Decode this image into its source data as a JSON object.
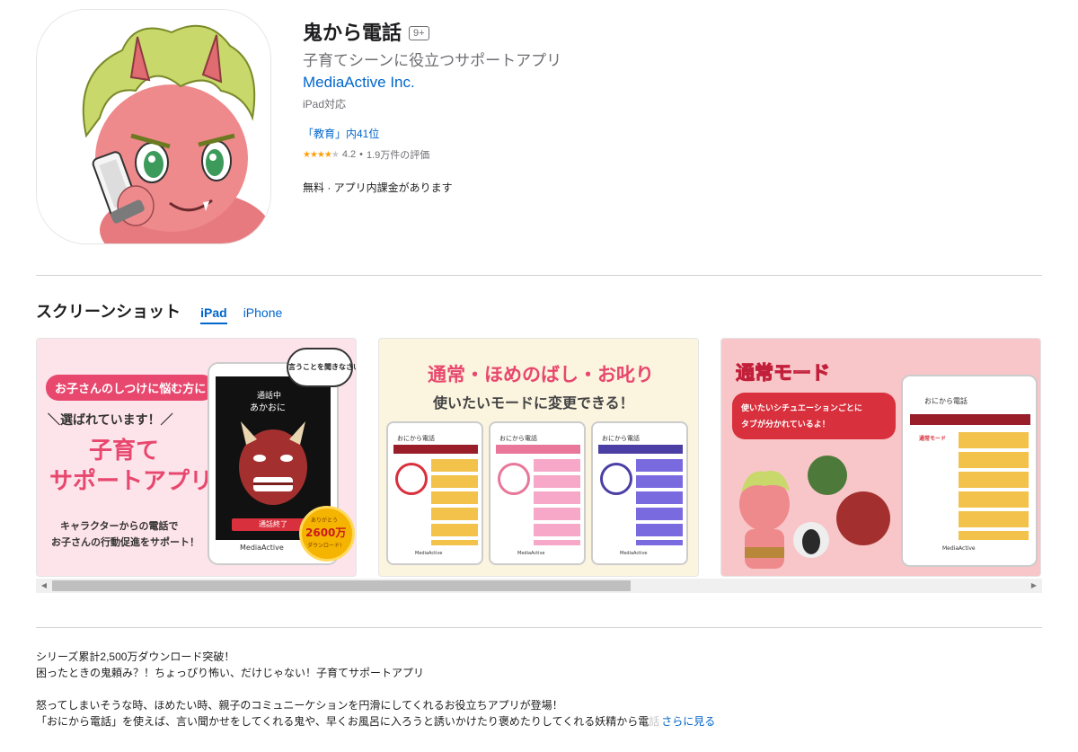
{
  "app": {
    "title": "鬼から電話",
    "age_rating": "9+",
    "subtitle": "子育てシーンに役立つサポートアプリ",
    "developer": "MediaActive Inc.",
    "device_note": "iPad対応",
    "rank": "「教育」内41位",
    "rating_value": "4.2",
    "rating_count": "1.9万件の評価",
    "price_line": "無料 · アプリ内課金があります"
  },
  "screenshots_section": {
    "title": "スクリーンショット",
    "tabs": [
      "iPad",
      "iPhone"
    ],
    "active_tab": "iPad"
  },
  "shot1": {
    "badge": "お子さんのしつけに悩む方に",
    "chosen": "＼選ばれています！／",
    "headline1": "子育て",
    "headline2": "サポートアプリ",
    "caption1": "キャラクターからの電話で",
    "caption2": "お子さんの行動促進をサポート！",
    "call_status": "通話中",
    "caller": "あかおに",
    "end_call": "通話終了",
    "bubble": "言うことを聞きなさい！",
    "medal_top": "ありがとう",
    "medal_num": "2600万",
    "medal_bottom": "ダウンロード!",
    "brand": "MediaActive"
  },
  "shot2": {
    "modes": "通常・ほめのばし・お叱り",
    "sub": "使いたいモードに変更できる！",
    "app_name": "おにから電話",
    "brand": "MediaActive"
  },
  "shot3": {
    "title": "通常モード",
    "bubble1": "使いたいシチュエーションごとに",
    "bubble2": "タブが分かれているよ！",
    "app_name": "おにから電話",
    "mode_label": "通常モード",
    "brand": "MediaActive"
  },
  "description": {
    "line1": "シリーズ累計2,500万ダウンロード突破！",
    "line2": "困ったときの鬼頼み？！ちょっぴり怖い、だけじゃない！子育てサポートアプリ",
    "line3": "怒ってしまいそうな時、ほめたい時、親子のコミュニーケションを円滑にしてくれるお役立ちアプリが登場！",
    "line4": "「おにから電話」を使えば、言い聞かせをしてくれる鬼や、早くお風呂に入ろうと誘いかけたり褒めたりしてくれる妖精から電",
    "line4_fade": "話",
    "more_link": "さらに見る"
  },
  "colors": {
    "link": "#0066cc",
    "star": "#ff9f0a",
    "shot1_bg": "#fde3ea",
    "shot2_bg": "#fbf4df",
    "shot3_bg": "#f8c6c8",
    "accent_pink": "#e8476e"
  }
}
